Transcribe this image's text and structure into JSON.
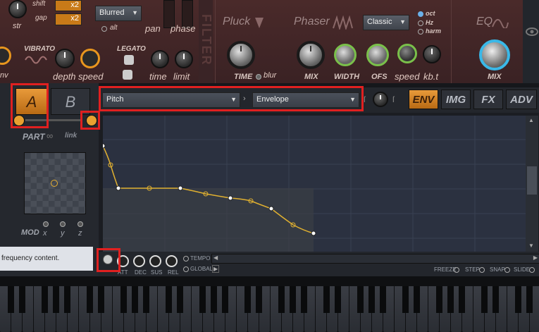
{
  "top": {
    "shift_label": "shift",
    "gap_label": "gap",
    "str_label": "str",
    "x2_a": "x2",
    "x2_b": "x2",
    "filter_dropdown": "Blurred",
    "alt_label": "alt",
    "pan_label": "pan",
    "phase_label": "phase",
    "vibrato_label": "VIBRATO",
    "env_label": "nv",
    "depth_label": "depth",
    "speed_label": "speed",
    "legato_label": "LEGATO",
    "time_label": "time",
    "limit_label": "limit",
    "pluck_label": "Pluck",
    "pluck_time_label": "TIME",
    "blur_label": "blur",
    "phaser_label": "Phaser",
    "phaser_mode": "Classic",
    "phaser_options": [
      "oct",
      "Hz",
      "harm"
    ],
    "phaser_mix_label": "MIX",
    "phaser_width_label": "WIDTH",
    "phaser_ofs_label": "OFS",
    "phaser_speed_label": "speed",
    "phaser_kbt_label": "kb.t",
    "eq_label": "EQ",
    "eq_mix_label": "MIX",
    "vertical_title": "FILTER"
  },
  "left": {
    "tab_a": "A",
    "tab_b": "B",
    "part_label": "PART",
    "link_label": "link",
    "mod_label": "MOD",
    "x_label": "x",
    "y_label": "y",
    "z_label": "z",
    "hint_text": "frequency content."
  },
  "editor": {
    "target_dropdown": "Pitch",
    "type_dropdown": "Envelope",
    "tabs": [
      "ENV",
      "IMG",
      "FX",
      "ADV"
    ],
    "knob_labels": [
      "ATT",
      "DEC",
      "SUS",
      "REL"
    ],
    "tempo_label": "TEMPO",
    "global_label": "GLOBAL",
    "options": [
      "FREEZE",
      "STEP",
      "SNAP",
      "SLIDE"
    ]
  },
  "colors": {
    "accent": "#e8961e",
    "envelope": "#e0b030",
    "highlight": "#e02020",
    "graph_bg": "#2b3140"
  }
}
